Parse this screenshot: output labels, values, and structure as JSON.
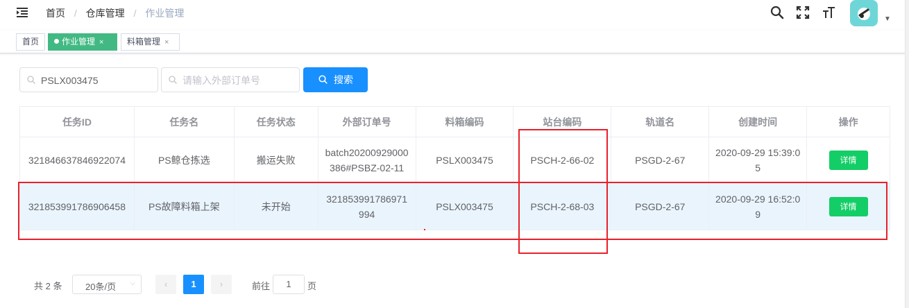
{
  "breadcrumb": [
    "首页",
    "仓库管理",
    "作业管理"
  ],
  "breadcrumb_separator": "/",
  "avatar_color": "#6fd6d8",
  "tags": [
    {
      "label": "首页",
      "active": false
    },
    {
      "label": "作业管理",
      "active": true,
      "close": "×"
    },
    {
      "label": "料箱管理",
      "active": false,
      "close": "×"
    }
  ],
  "search": {
    "task_value": "PSLX003475",
    "order_placeholder": "请输入外部订单号",
    "button_label": "搜索"
  },
  "table": {
    "headers": [
      "任务ID",
      "任务名",
      "任务状态",
      "外部订单号",
      "料箱编码",
      "站台编码",
      "轨道名",
      "创建时间",
      "操作"
    ],
    "rows": [
      {
        "task_id": "321846637846922074",
        "task_name": "PS鲸仓拣选",
        "status": "搬运失败",
        "order_no": "batch20200929000386#PSBZ-02-11",
        "box_code": "PSLX003475",
        "station_code": "PSCH-2-66-02",
        "track": "PSGD-2-67",
        "created": "2020-09-29 15:39:05",
        "action": "详情"
      },
      {
        "task_id": "321853991786906458",
        "task_name": "PS故障料箱上架",
        "status": "未开始",
        "order_no": "321853991786971994",
        "box_code": "PSLX003475",
        "station_code": "PSCH-2-68-03",
        "track": "PSGD-2-67",
        "created": "2020-09-29 16:52:09",
        "action": "详情"
      }
    ]
  },
  "pagination": {
    "total": "共 2 条",
    "page_size": "20条/页",
    "current_page": "1",
    "goto_prefix": "前往",
    "goto_value": "1",
    "goto_suffix": "页"
  },
  "colors": {
    "primary": "#1890ff",
    "success": "#13ce66",
    "tag_active": "#42b983",
    "annotation": "#e8202a"
  }
}
